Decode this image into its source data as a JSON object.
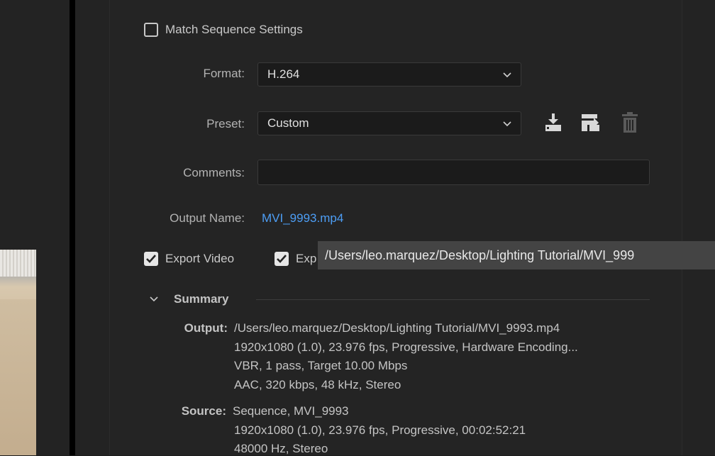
{
  "match_sequence": {
    "label": "Match Sequence Settings",
    "checked": false
  },
  "format": {
    "label": "Format:",
    "value": "H.264"
  },
  "preset": {
    "label": "Preset:",
    "value": "Custom"
  },
  "preset_actions": [
    {
      "icon": "save-preset-icon"
    },
    {
      "icon": "import-preset-icon"
    },
    {
      "icon": "delete-preset-icon"
    }
  ],
  "comments": {
    "label": "Comments:",
    "value": ""
  },
  "output_name": {
    "label": "Output Name:",
    "value": "MVI_9993.mp4"
  },
  "export_video": {
    "label": "Export Video",
    "checked": true
  },
  "export_audio": {
    "label": "Exp",
    "checked": true
  },
  "tooltip": {
    "text": "/Users/leo.marquez/Desktop/Lighting Tutorial/MVI_999"
  },
  "summary": {
    "title": "Summary",
    "output_key": "Output:",
    "output_lines": [
      "/Users/leo.marquez/Desktop/Lighting Tutorial/MVI_9993.mp4",
      "1920x1080 (1.0), 23.976 fps, Progressive, Hardware Encoding...",
      "VBR, 1 pass, Target 10.00 Mbps",
      "AAC, 320 kbps, 48 kHz, Stereo"
    ],
    "source_key": "Source:",
    "source_lines": [
      "Sequence, MVI_9993",
      "1920x1080 (1.0), 23.976 fps, Progressive, 00:02:52:21",
      "48000 Hz, Stereo"
    ]
  },
  "colors": {
    "link": "#4d9ef5",
    "panel": "#242424",
    "input": "#1b1b1b"
  }
}
